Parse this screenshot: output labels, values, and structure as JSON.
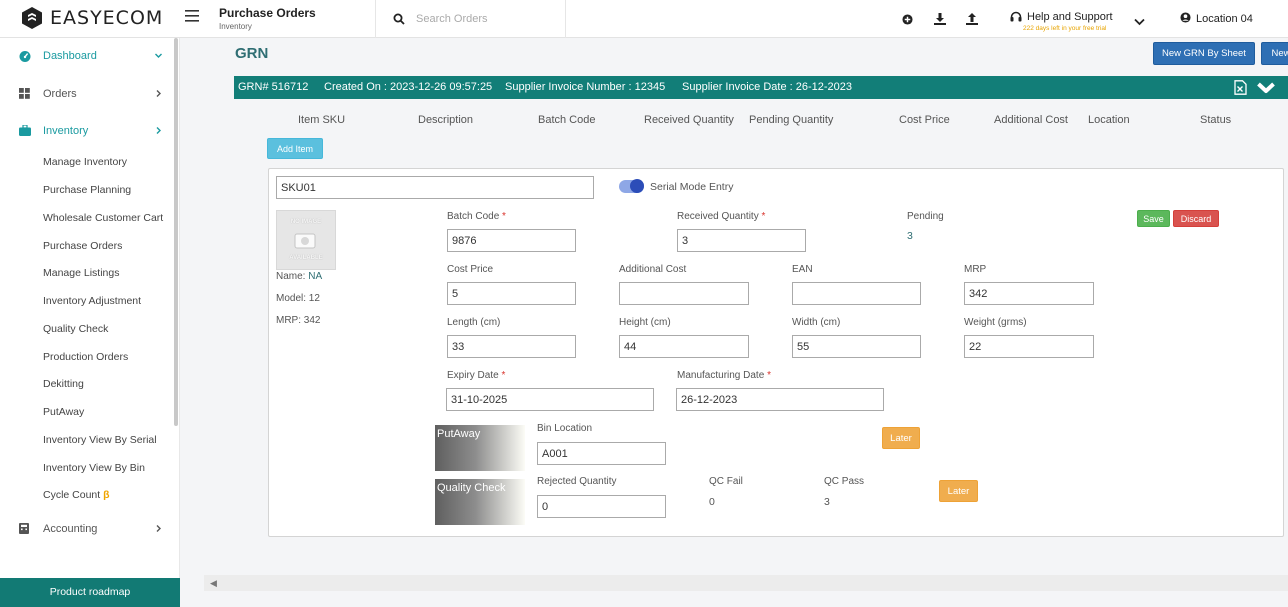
{
  "app": {
    "brand": "EASYECOM",
    "page_title": "Purchase Orders",
    "page_subtitle": "Inventory"
  },
  "search": {
    "placeholder": "Search Orders"
  },
  "help": {
    "label": "Help and Support",
    "trial": "222 days left in your free trial"
  },
  "location": {
    "label": "Location 04"
  },
  "sidebar": {
    "main": [
      {
        "label": "Dashboard",
        "icon": "dashboard-icon"
      },
      {
        "label": "Orders",
        "icon": "grid-icon"
      },
      {
        "label": "Inventory",
        "icon": "briefcase-icon"
      },
      {
        "label": "Accounting",
        "icon": "calculator-icon"
      }
    ],
    "sub": [
      "Manage Inventory",
      "Purchase Planning",
      "Wholesale Customer Cart",
      "Purchase Orders",
      "Manage Listings",
      "Inventory Adjustment",
      "Quality Check",
      "Production Orders",
      "Dekitting",
      "PutAway",
      "Inventory View By Serial",
      "Inventory View By Bin",
      "Cycle Count"
    ],
    "beta_mark": "β",
    "roadmap": "Product roadmap"
  },
  "main": {
    "title": "GRN",
    "buttons": {
      "new_grn_sheet": "New GRN By Sheet",
      "new": "New"
    },
    "banner": {
      "grn": "GRN# 516712",
      "created": "Created On : 2023-12-26 09:57:25",
      "invoice_number": "Supplier Invoice Number : 12345",
      "invoice_date": "Supplier Invoice Date : 26-12-2023"
    },
    "columns": [
      "Item SKU",
      "Description",
      "Batch Code",
      "Received Quantity",
      "Pending Quantity",
      "Cost Price",
      "Additional Cost",
      "Location",
      "Status"
    ],
    "add_item": "Add Item"
  },
  "item": {
    "sku": "SKU01",
    "serial_mode_label": "Serial Mode Entry",
    "no_image": {
      "line1": "NO IMAGE",
      "line2": "AVAILABLE"
    },
    "name_label": "Name:",
    "name_value": "NA",
    "model": "Model: 12",
    "mrp_info": "MRP: 342",
    "batch_code_label": "Batch Code",
    "batch_code": "9876",
    "received_qty_label": "Received Quantity",
    "received_qty": "3",
    "pending_label": "Pending",
    "pending": "3",
    "save": "Save",
    "discard": "Discard",
    "cost_price_label": "Cost Price",
    "cost_price": "5",
    "additional_cost_label": "Additional Cost",
    "additional_cost": "",
    "ean_label": "EAN",
    "ean": "",
    "mrp_label": "MRP",
    "mrp": "342",
    "length_label": "Length (cm)",
    "length": "33",
    "height_label": "Height (cm)",
    "height": "44",
    "width_label": "Width (cm)",
    "width": "55",
    "weight_label": "Weight (grms)",
    "weight": "22",
    "expiry_label": "Expiry Date",
    "expiry": "31-10-2025",
    "mfg_label": "Manufacturing Date",
    "mfg": "26-12-2023",
    "required_mark": "*",
    "putaway_label": "PutAway",
    "bin_location_label": "Bin Location",
    "bin_location": "A001",
    "later": "Later",
    "qc_label": "Quality Check",
    "rejected_label": "Rejected Quantity",
    "rejected": "0",
    "qc_fail_label": "QC Fail",
    "qc_fail": "0",
    "qc_pass_label": "QC Pass",
    "qc_pass": "3"
  },
  "colors": {
    "teal": "#127e78",
    "accent": "#1a9aa0",
    "blue_button": "#2e6fb4",
    "orange": "#f0ad4e"
  }
}
